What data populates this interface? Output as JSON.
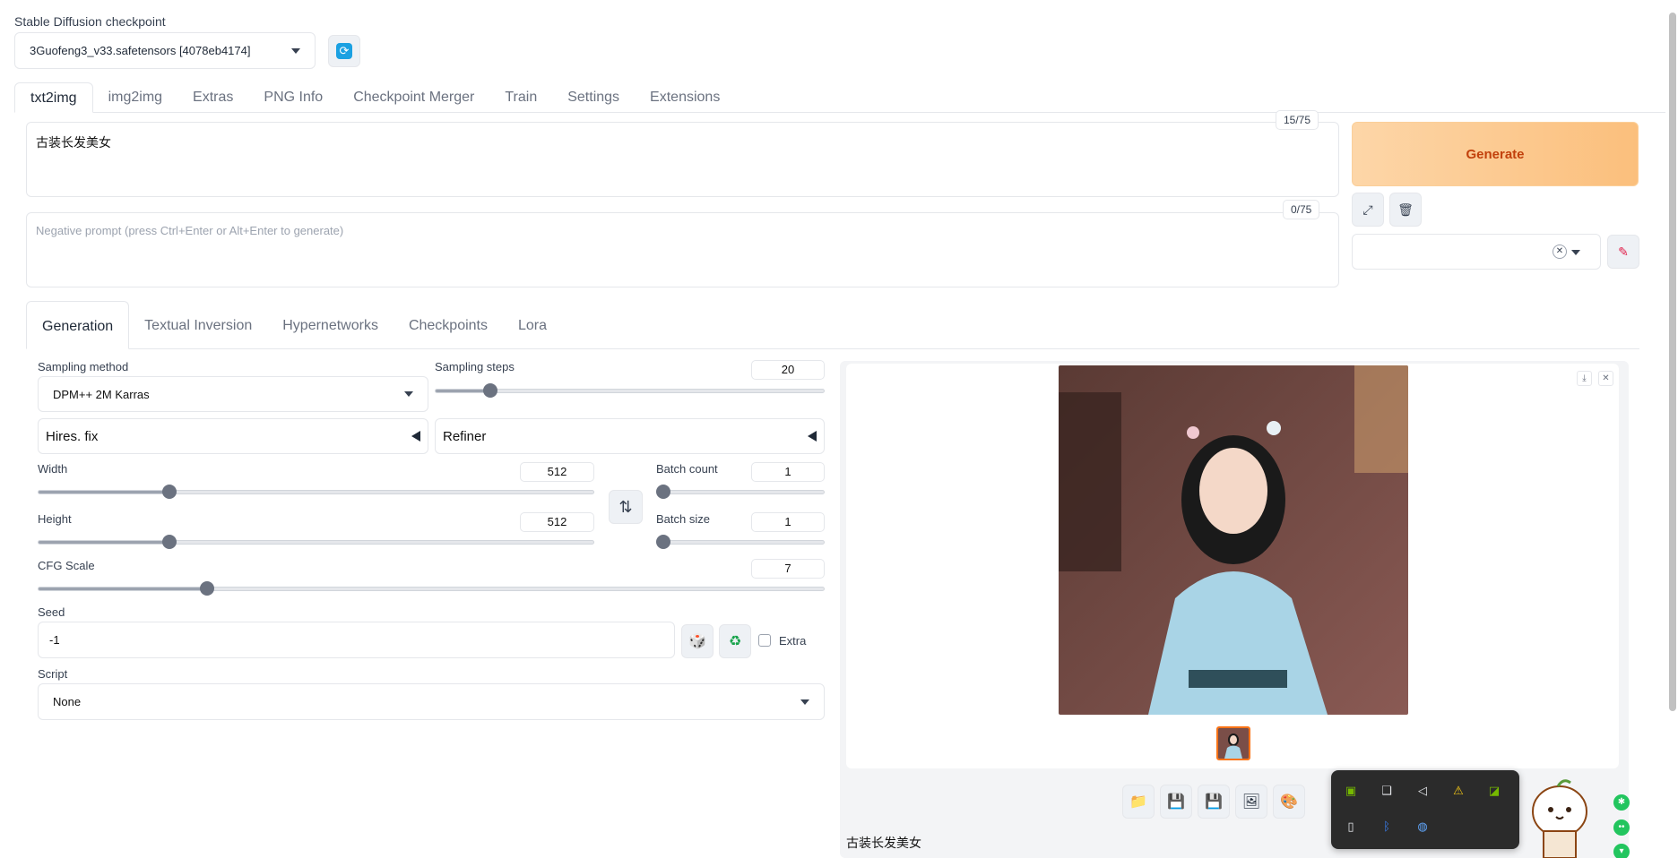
{
  "checkpoint": {
    "label": "Stable Diffusion checkpoint",
    "value": "3Guofeng3_v33.safetensors [4078eb4174]"
  },
  "main_tabs": [
    {
      "label": "txt2img",
      "active": true
    },
    {
      "label": "img2img"
    },
    {
      "label": "Extras"
    },
    {
      "label": "PNG Info"
    },
    {
      "label": "Checkpoint Merger"
    },
    {
      "label": "Train"
    },
    {
      "label": "Settings"
    },
    {
      "label": "Extensions"
    }
  ],
  "prompt": {
    "value": "古装长发美女",
    "counter": "15/75"
  },
  "negative_prompt": {
    "placeholder": "Negative prompt (press Ctrl+Enter or Alt+Enter to generate)",
    "counter": "0/75"
  },
  "generate_label": "Generate",
  "sub_tabs": [
    {
      "label": "Generation",
      "active": true
    },
    {
      "label": "Textual Inversion"
    },
    {
      "label": "Hypernetworks"
    },
    {
      "label": "Checkpoints"
    },
    {
      "label": "Lora"
    }
  ],
  "generation": {
    "sampling_method_label": "Sampling method",
    "sampling_method": "DPM++ 2M Karras",
    "sampling_steps_label": "Sampling steps",
    "sampling_steps": "20",
    "hires_fix_label": "Hires. fix",
    "refiner_label": "Refiner",
    "width_label": "Width",
    "width": "512",
    "height_label": "Height",
    "height": "512",
    "batch_count_label": "Batch count",
    "batch_count": "1",
    "batch_size_label": "Batch size",
    "batch_size": "1",
    "cfg_label": "CFG Scale",
    "cfg": "7",
    "seed_label": "Seed",
    "seed": "-1",
    "extra_label": "Extra",
    "script_label": "Script",
    "script": "None"
  },
  "slider_levels": {
    "sampling_steps": 0.13,
    "width": 0.23,
    "height": 0.23,
    "batch_count": 0.0,
    "batch_size": 0.0,
    "cfg": 0.21
  },
  "output": {
    "caption": "古装长发美女"
  },
  "colors": {
    "accent_orange": "#f97316",
    "generate_text": "#c2410c",
    "refresh_blue": "#1ba1e2"
  }
}
